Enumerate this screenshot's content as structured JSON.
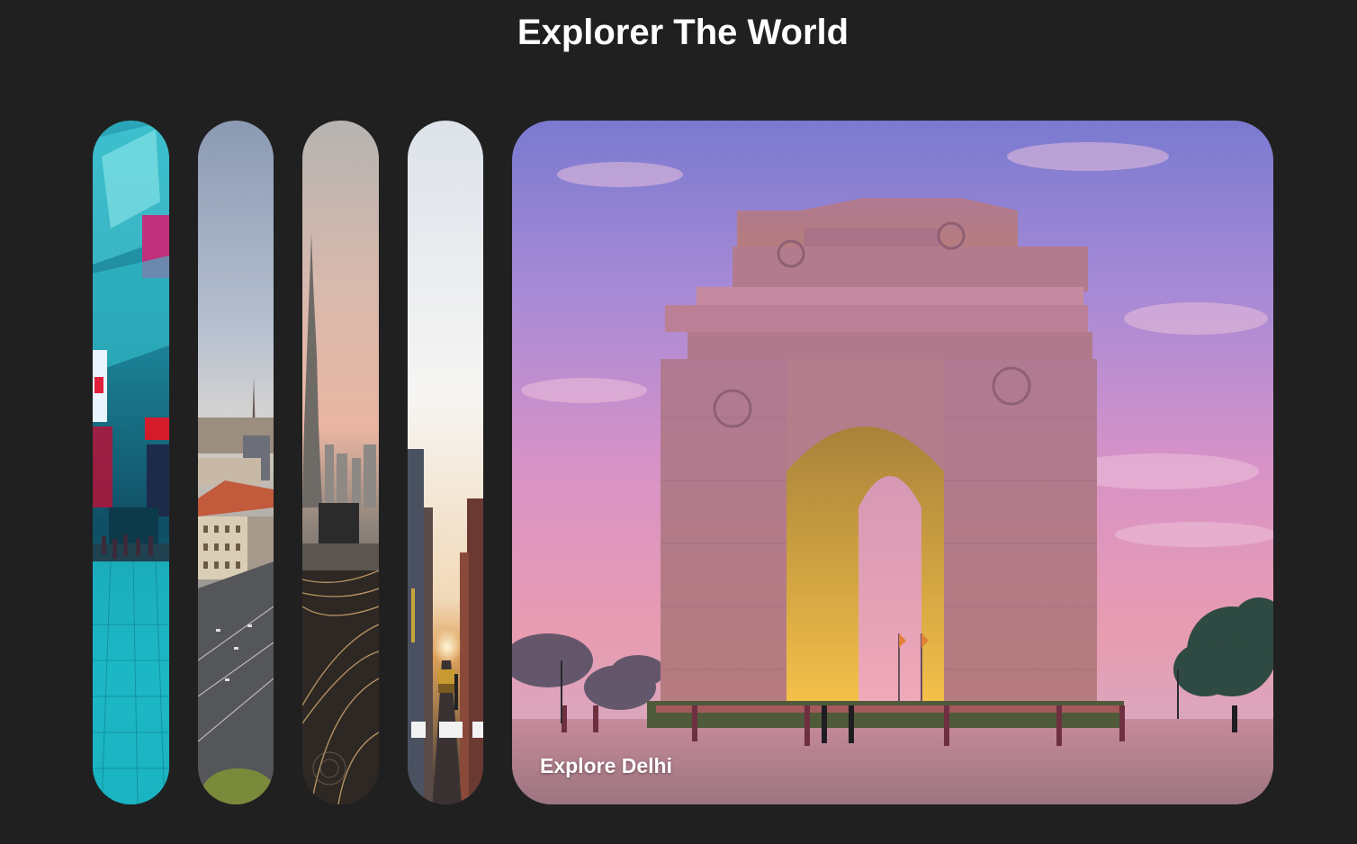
{
  "page": {
    "title": "Explorer The World"
  },
  "panels": [
    {
      "id": "tokyo",
      "image": "neon-city-street"
    },
    {
      "id": "city-highway",
      "image": "european-city-highway"
    },
    {
      "id": "dubai",
      "image": "burj-khalifa-interchange"
    },
    {
      "id": "new-york",
      "image": "manhattan-sunset-street"
    },
    {
      "id": "delhi",
      "image": "india-gate-sunset",
      "caption": "Explore Delhi",
      "active": true
    }
  ],
  "colors": {
    "background": "#202020",
    "title": "#ffffff",
    "caption": "#ffffff"
  }
}
